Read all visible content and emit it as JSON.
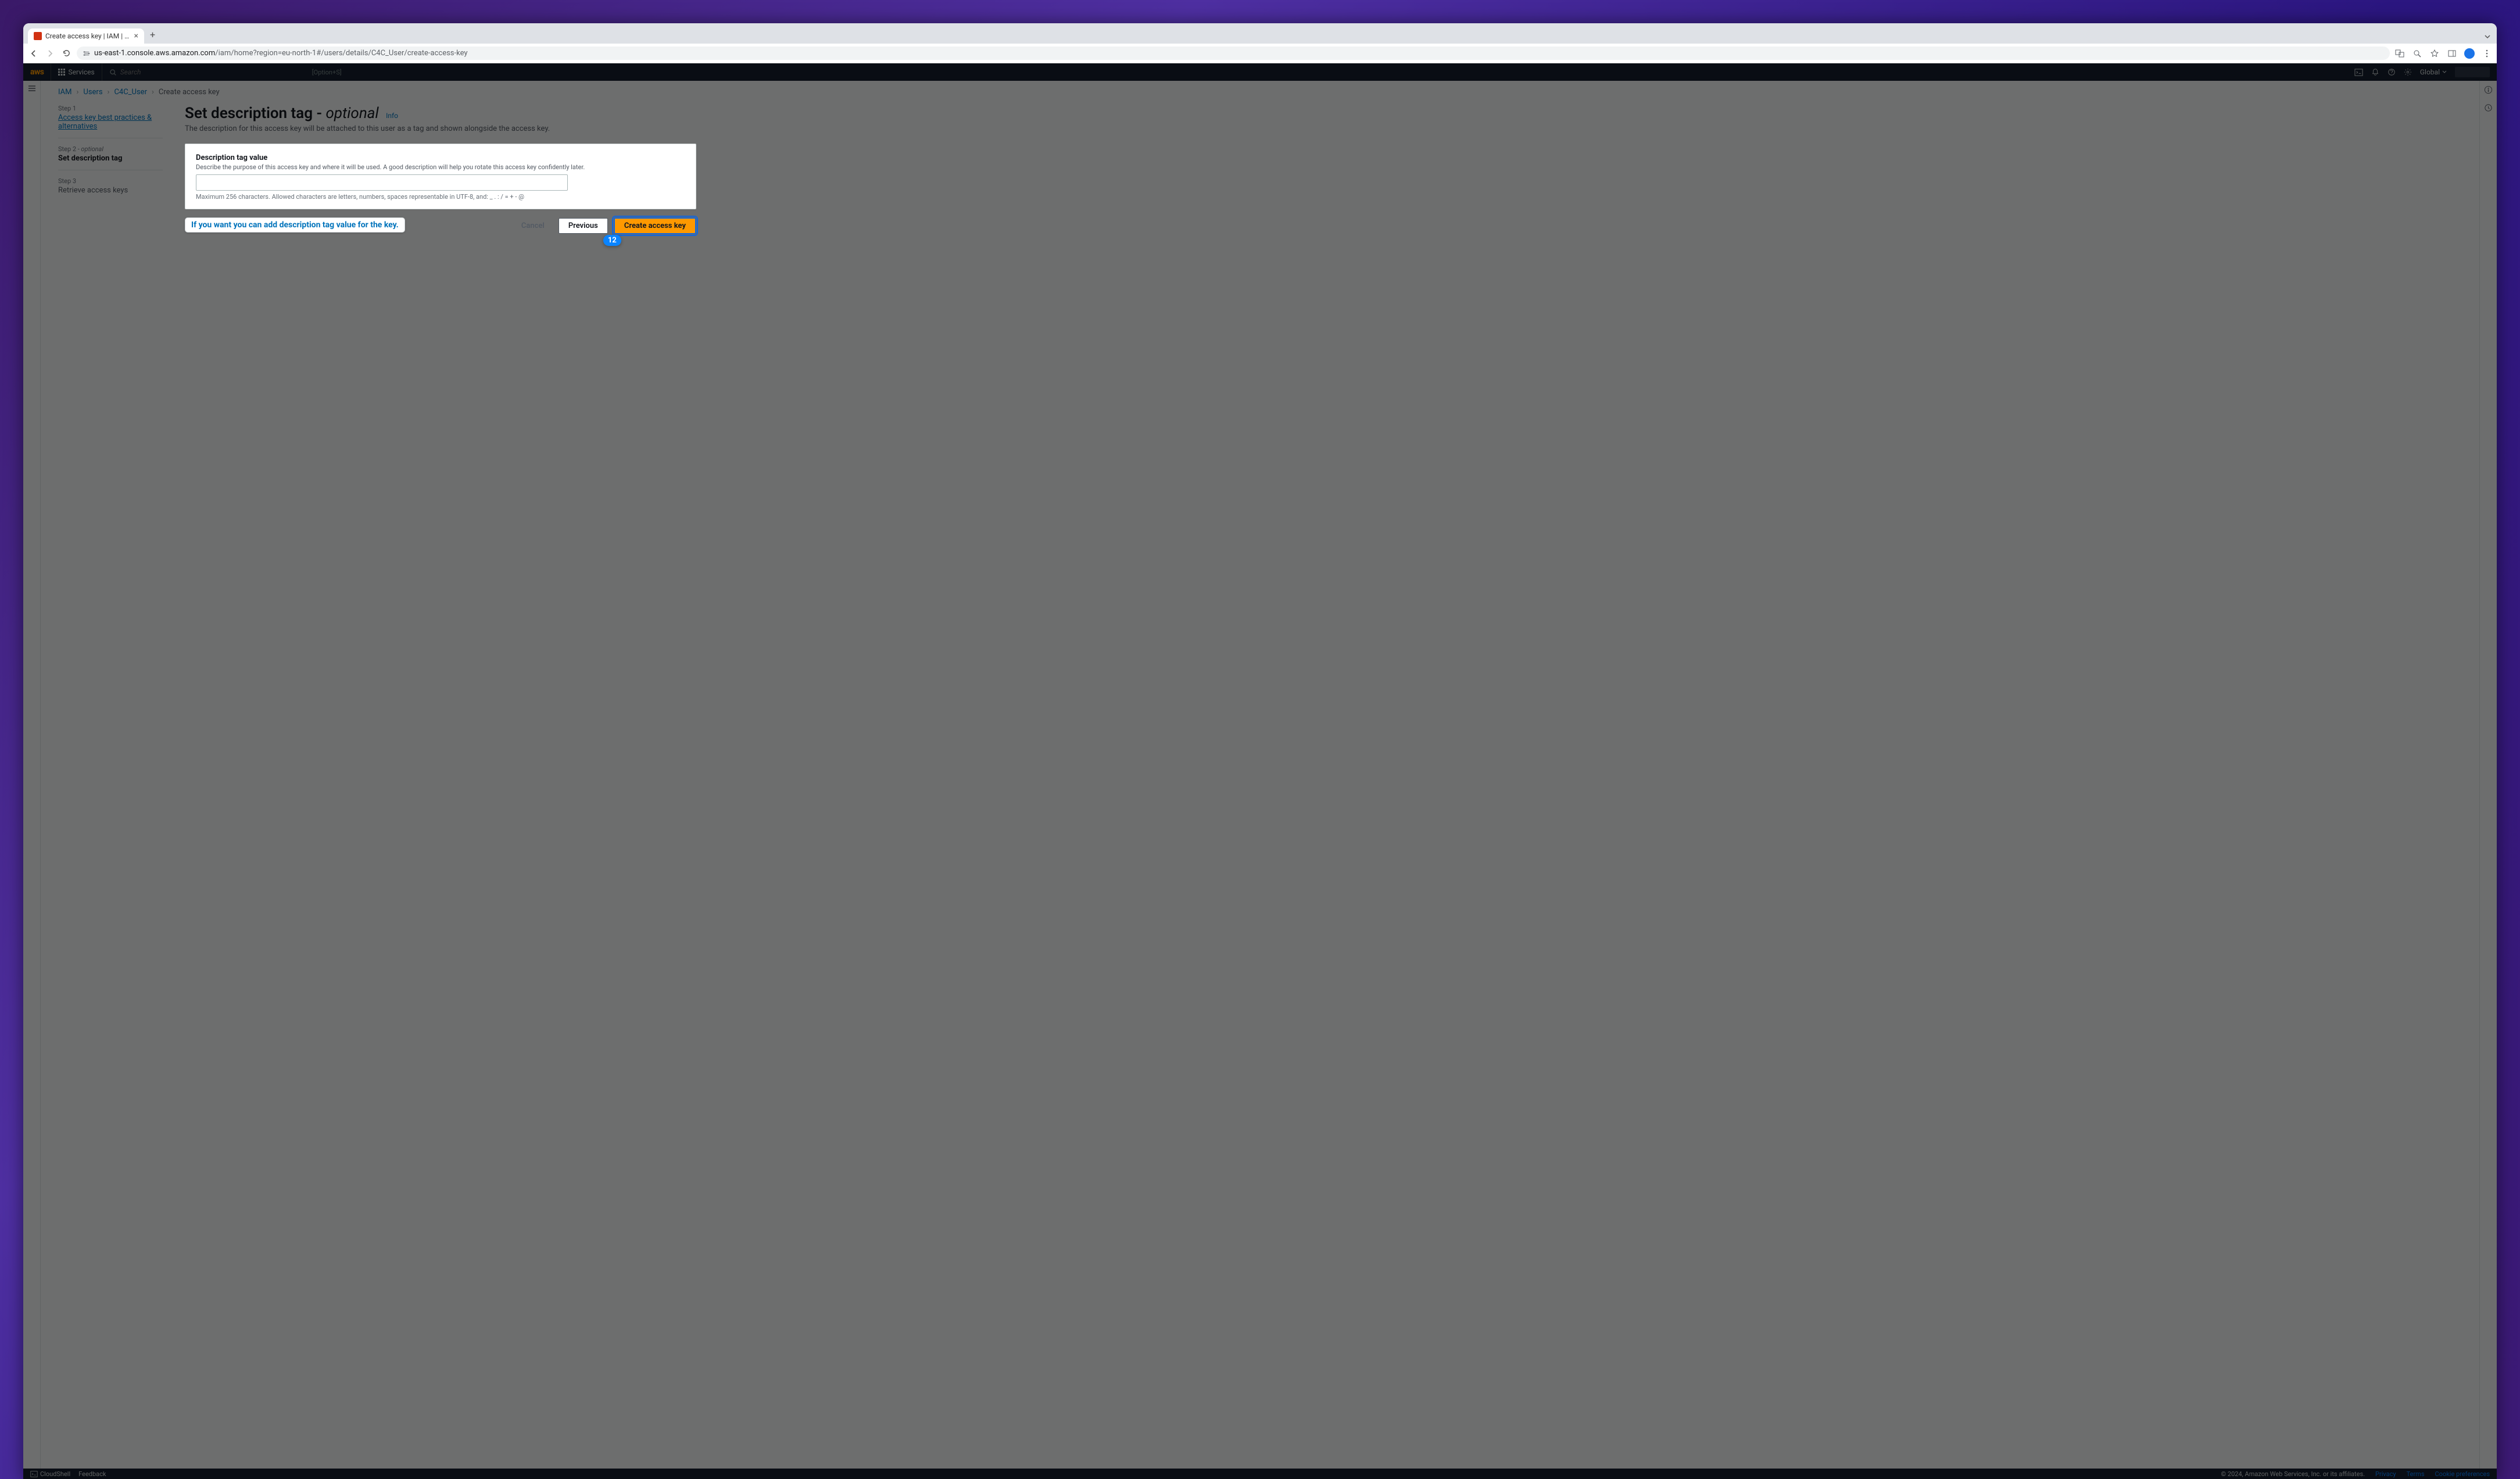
{
  "browser": {
    "tab_title": "Create access key | IAM | Glo",
    "url_host": "us-east-1.console.aws.amazon.com",
    "url_path": "/iam/home?region=eu-north-1#/users/details/C4C_User/create-access-key",
    "shortcut_hint": "[Option+S]",
    "search_placeholder": "Search"
  },
  "aws_header": {
    "logo": "aws",
    "services": "Services",
    "region": "Global"
  },
  "breadcrumbs": {
    "iam": "IAM",
    "users": "Users",
    "user": "C4C_User",
    "current": "Create access key"
  },
  "steps": {
    "s1_num": "Step 1",
    "s1_label": "Access key best practices & alternatives",
    "s2_num_pre": "Step 2",
    "s2_num_opt": " - optional",
    "s2_label": "Set description tag",
    "s3_num": "Step 3",
    "s3_label": "Retrieve access keys"
  },
  "page": {
    "title_main": "Set description tag",
    "title_sep": " - ",
    "title_optional": "optional",
    "info": "Info",
    "description": "The description for this access key will be attached to this user as a tag and shown alongside the access key."
  },
  "form": {
    "label": "Description tag value",
    "hint": "Describe the purpose of this access key and where it will be used. A good description will help you rotate this access key confidently later.",
    "constraint": "Maximum 256 characters. Allowed characters are letters, numbers, spaces representable in UTF-8, and: _ . : / = + - @"
  },
  "actions": {
    "cancel": "Cancel",
    "previous": "Previous",
    "create": "Create access key"
  },
  "annotation": {
    "callout": "If you want you can add description tag value for the key.",
    "badge": "12"
  },
  "footer": {
    "cloudshell": "CloudShell",
    "feedback": "Feedback",
    "copyright": "© 2024, Amazon Web Services, Inc. or its affiliates.",
    "privacy": "Privacy",
    "terms": "Terms",
    "cookies": "Cookie preferences"
  }
}
